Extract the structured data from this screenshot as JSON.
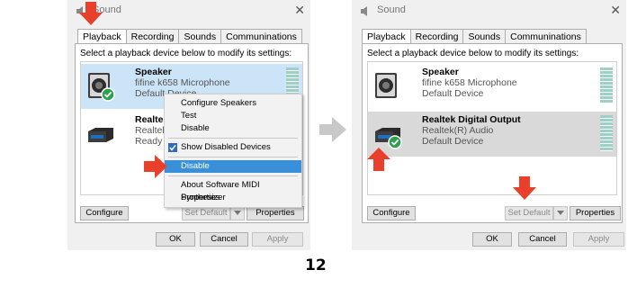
{
  "left": {
    "title": "Sound",
    "tabs": [
      "Playback",
      "Recording",
      "Sounds",
      "Communinations"
    ],
    "instruction": "Select a playback device below to modify its settings:",
    "devices": [
      {
        "name": "Speaker",
        "line1": "fifine k658 Microphone",
        "line2": "Default Device"
      },
      {
        "name": "Realtek Digital Output",
        "line1": "Realtek(R) Audio",
        "line2": "Ready"
      }
    ],
    "context_menu": [
      "Configure Speakers",
      "Test",
      "Disable",
      "Show Disabled Devices",
      "Disable",
      "About Software MIDI Synthesizer",
      "Properties"
    ],
    "buttons": {
      "configure": "Configure",
      "set_default": "Set Default",
      "properties": "Properties",
      "ok": "OK",
      "cancel": "Cancel",
      "apply": "Apply"
    }
  },
  "right": {
    "title": "Sound",
    "tabs": [
      "Playback",
      "Recording",
      "Sounds",
      "Communinations"
    ],
    "instruction": "Select a playback device below to modify its settings:",
    "devices": [
      {
        "name": "Speaker",
        "line1": "fifine k658 Microphone",
        "line2": "Default Device"
      },
      {
        "name": "Realtek Digital Output",
        "line1": "Realtek(R) Audio",
        "line2": "Default Device"
      }
    ],
    "buttons": {
      "configure": "Configure",
      "set_default": "Set Default",
      "properties": "Properties",
      "ok": "OK",
      "cancel": "Cancel",
      "apply": "Apply"
    }
  },
  "page_number": "12",
  "colors": {
    "arrow": "#e8402a",
    "selection_blue": "#cce4f7",
    "selection_gray": "#d9d9d9",
    "menu_highlight": "#3a8fd9",
    "check_green": "#2e9e4f"
  }
}
